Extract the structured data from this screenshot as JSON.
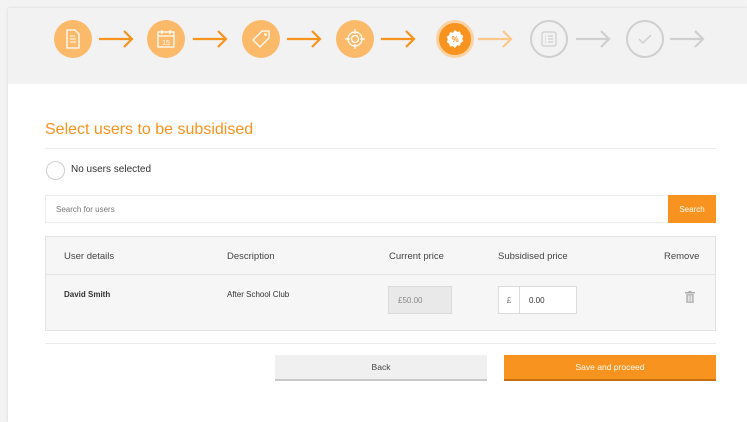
{
  "steps": [
    {
      "icon": "document-icon",
      "state": "done"
    },
    {
      "icon": "calendar-icon",
      "state": "done",
      "text": "15"
    },
    {
      "icon": "tag-icon",
      "state": "done"
    },
    {
      "icon": "target-icon",
      "state": "done"
    },
    {
      "icon": "percent-icon",
      "state": "current",
      "text": "%"
    },
    {
      "icon": "list-icon",
      "state": "todo"
    },
    {
      "icon": "check-icon",
      "state": "todo"
    }
  ],
  "colors": {
    "accent": "#f7931e",
    "accent_light": "#fbb96a",
    "inactive": "#cfcfcf"
  },
  "section": {
    "title": "Select users to be subsidised"
  },
  "selection": {
    "label": "No users selected"
  },
  "search": {
    "placeholder": "Search for users",
    "button_label": "Search"
  },
  "table": {
    "headers": [
      "User details",
      "Description",
      "Current price",
      "Subsidised price",
      "Remove"
    ],
    "rows": [
      {
        "user": "David Smith",
        "description": "After School Club",
        "current_price": "£50.00",
        "currency": "£",
        "subsidised_price": "0.00",
        "remove_icon": "trash-icon"
      }
    ]
  },
  "actions": {
    "back_label": "Back",
    "save_label": "Save and proceed"
  }
}
